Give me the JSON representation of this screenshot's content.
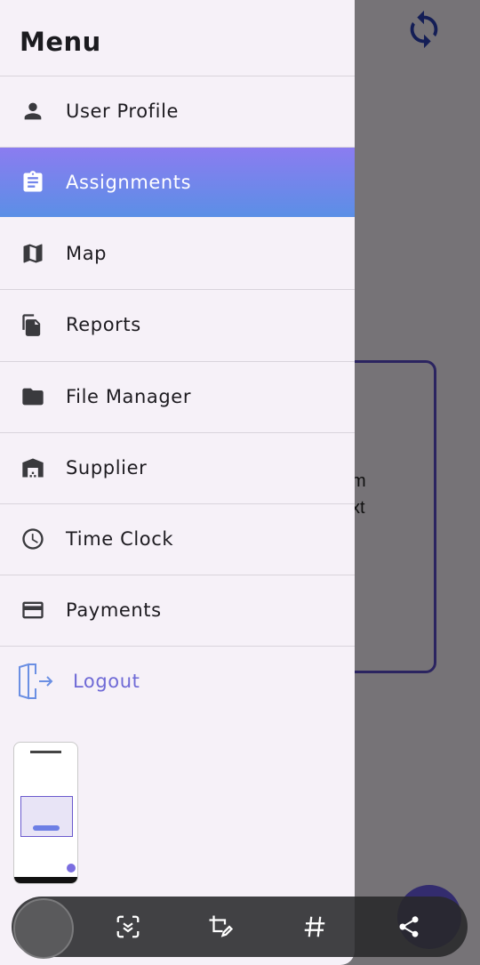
{
  "drawer": {
    "title": "Menu",
    "items": [
      {
        "label": "User Profile",
        "icon": "person-icon"
      },
      {
        "label": "Assignments",
        "icon": "clipboard-icon",
        "active": true
      },
      {
        "label": "Map",
        "icon": "map-icon"
      },
      {
        "label": "Reports",
        "icon": "documents-icon"
      },
      {
        "label": "File Manager",
        "icon": "folder-icon"
      },
      {
        "label": "Supplier",
        "icon": "warehouse-icon"
      },
      {
        "label": "Time Clock",
        "icon": "clock-icon"
      },
      {
        "label": "Payments",
        "icon": "wallet-icon"
      }
    ],
    "logout": {
      "label": "Logout",
      "icon": "logout-icon"
    }
  },
  "background": {
    "card_text_lines": [
      "m",
      "xt"
    ]
  },
  "colors": {
    "accent_gradient_start": "#8b7cf0",
    "accent_gradient_end": "#5b8fe6",
    "logout": "#6f6ad6",
    "refresh": "#2b3fb5"
  },
  "toolbar": {
    "buttons": [
      "scan-icon",
      "crop-edit-icon",
      "hashtag-icon",
      "share-icon"
    ]
  }
}
